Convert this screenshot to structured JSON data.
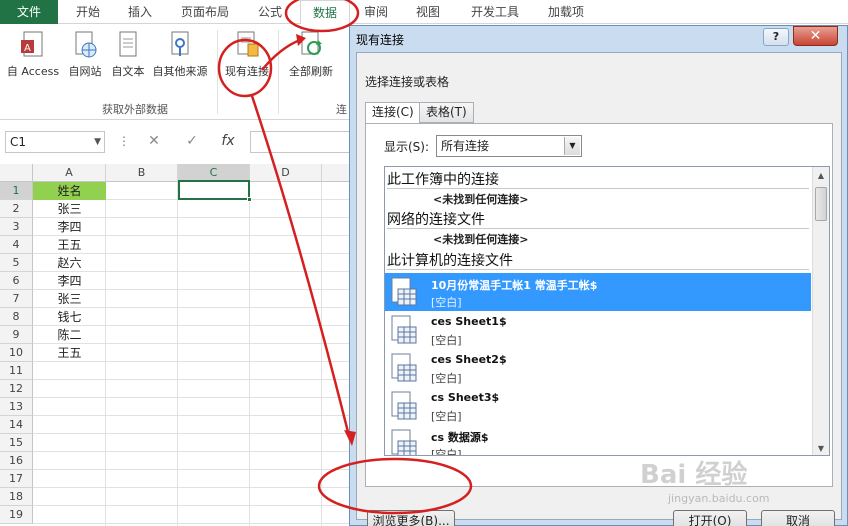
{
  "ribbon_tabs": [
    "文件",
    "开始",
    "插入",
    "页面布局",
    "公式",
    "数据",
    "审阅",
    "视图",
    "开发工具",
    "加载项"
  ],
  "active_tab": "数据",
  "ribbon_buttons": {
    "access": "自 Access",
    "web": "自网站",
    "text": "自文本",
    "other": "自其他来源",
    "existing": "现有连接",
    "refresh_all": "全部刷新"
  },
  "group_label": "获取外部数据",
  "group_label_2": "连",
  "name_box": "C1",
  "formula_icon": "fx",
  "columns": [
    "A",
    "B",
    "C",
    "D"
  ],
  "selected_column": "C",
  "rows": [
    "1",
    "2",
    "3",
    "4",
    "5",
    "6",
    "7",
    "8",
    "9",
    "10",
    "11",
    "12",
    "13",
    "14",
    "15",
    "16",
    "17",
    "18",
    "19"
  ],
  "selected_row": "1",
  "column_a_values": [
    "姓名",
    "张三",
    "李四",
    "王五",
    "赵六",
    "李四",
    "张三",
    "钱七",
    "陈二",
    "王五"
  ],
  "highlight_color": "#92d050",
  "accent_color": "#217346",
  "dialog": {
    "title": "现有连接",
    "help": "?",
    "prompt": "选择连接或表格",
    "tab_connections": "连接(C)",
    "tab_tables": "表格(T)",
    "show_label": "显示(S):",
    "show_value": "所有连接",
    "section_workbook": "此工作簿中的连接",
    "none_found_1": "<未找到任何连接>",
    "section_network": "网络的连接文件",
    "none_found_2": "<未找到任何连接>",
    "section_computer": "此计算机的连接文件",
    "items": [
      {
        "name": "10月份常温手工帐1 常温手工帐$",
        "status": "[空白]"
      },
      {
        "name": "ces Sheet1$",
        "status": "[空白]"
      },
      {
        "name": "ces Sheet2$",
        "status": "[空白]"
      },
      {
        "name": "cs Sheet3$",
        "status": "[空白]"
      },
      {
        "name": "cs 数据源$",
        "status": "[空白]"
      }
    ],
    "browse_button": "浏览更多(B)...",
    "open_button": "打开(O)",
    "cancel_button": "取消"
  },
  "watermark": "Bai 经验",
  "watermark_sub": "jingyan.baidu.com"
}
